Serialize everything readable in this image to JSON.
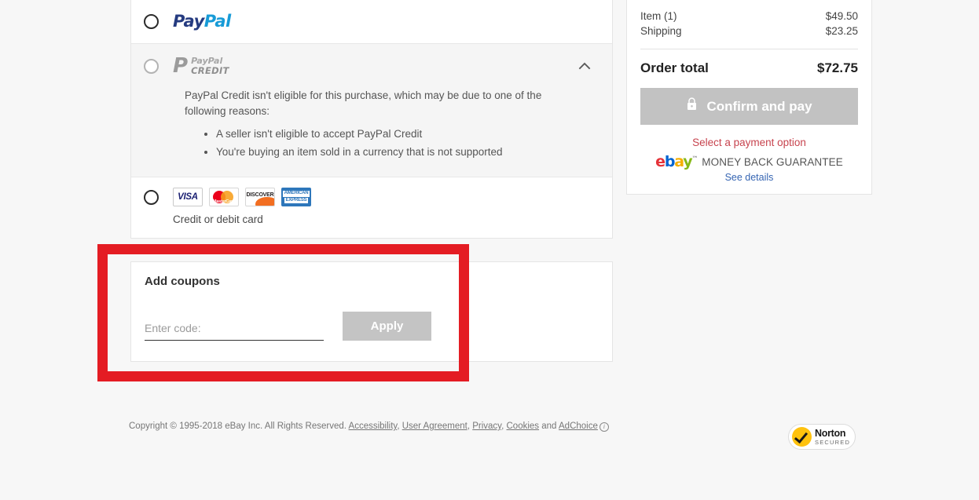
{
  "payment_methods": {
    "paypal": {
      "logo_part1": "Pay",
      "logo_part2": "Pal",
      "icon": "radio-unselected"
    },
    "paypal_credit": {
      "logo_mark": "P",
      "logo_line1": "PayPal",
      "logo_line2": "CREDIT",
      "collapse_icon": "chevron-up-icon",
      "ineligible_text": "PayPal Credit isn't eligible for this purchase, which may be due to one of the following reasons:",
      "reasons": [
        "A seller isn't eligible to accept PayPal Credit",
        "You're buying an item sold in a currency that is not supported"
      ]
    },
    "credit_card": {
      "caption": "Credit or debit card",
      "cards": [
        {
          "name": "visa",
          "label": "VISA"
        },
        {
          "name": "mastercard",
          "label": "MasterCard"
        },
        {
          "name": "discover",
          "label": "DISCOVER"
        },
        {
          "name": "amex",
          "label_line1": "AMERICAN",
          "label_line2": "EXPRESS"
        }
      ]
    }
  },
  "coupons": {
    "title": "Add coupons",
    "input_placeholder": "Enter code:",
    "input_value": "",
    "apply_label": "Apply"
  },
  "summary": {
    "lines": [
      {
        "label": "Item (1)",
        "value": "$49.50"
      },
      {
        "label": "Shipping",
        "value": "$23.25"
      }
    ],
    "total_label": "Order total",
    "total_value": "$72.75",
    "confirm_label": "Confirm and pay",
    "confirm_icon": "lock-icon",
    "warning": "Select a payment option",
    "guarantee": {
      "ebay_e": "e",
      "ebay_b": "b",
      "ebay_a": "a",
      "ebay_y": "y",
      "trademark": "™",
      "text": "MONEY BACK GUARANTEE",
      "link": "See details"
    }
  },
  "footer": {
    "copyright": "Copyright © 1995-2018 eBay Inc. All Rights Reserved.",
    "links": [
      "Accessibility",
      "User Agreement",
      "Privacy",
      "Cookies"
    ],
    "and_word": "and",
    "adchoice": "AdChoice",
    "info_icon": "information-icon",
    "sep": ",",
    "norton": {
      "line1": "Norton",
      "line2": "SECURED",
      "tm": "™",
      "icon": "check-badge-icon"
    }
  },
  "colors": {
    "paypal_dark": "#253b80",
    "paypal_light": "#179bd7",
    "highlight_red": "#e41c23",
    "warning_red": "#c7434e",
    "link_blue": "#3665b3",
    "ebay_red": "#e53238",
    "ebay_blue": "#0064d2",
    "ebay_yellow": "#f5af02",
    "ebay_green": "#86b817"
  }
}
